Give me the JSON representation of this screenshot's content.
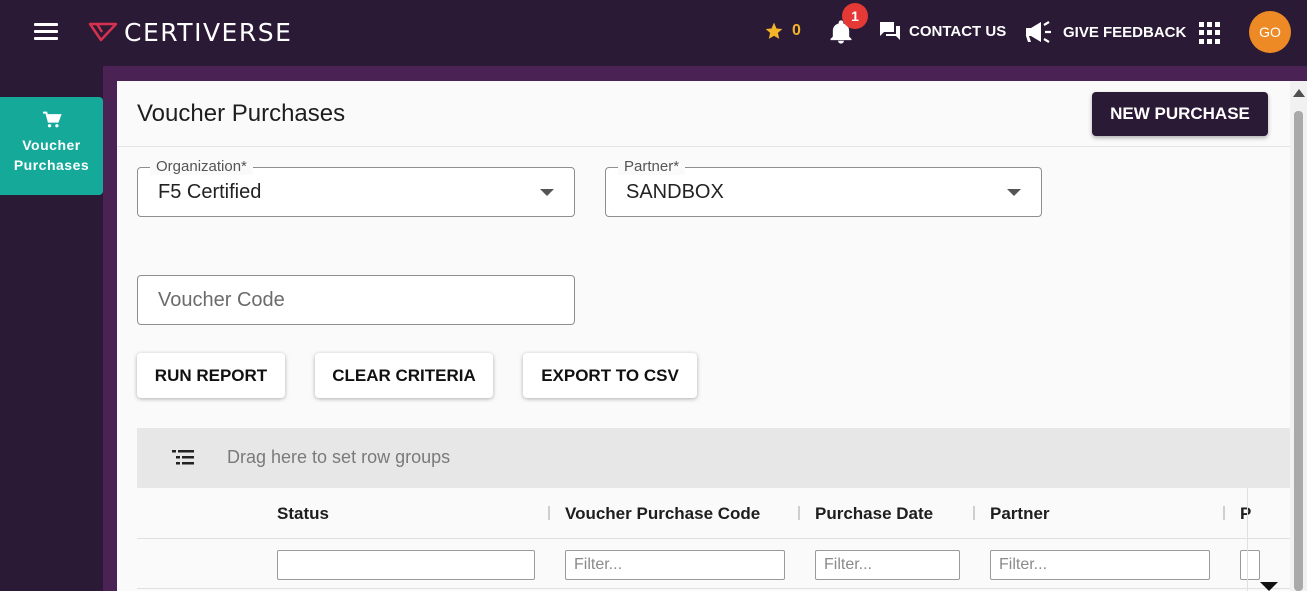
{
  "header": {
    "brand": "CERTIVERSE",
    "star_count": "0",
    "notification_count": "1",
    "contact_label": "CONTACT US",
    "feedback_label": "GIVE FEEDBACK",
    "avatar_initials": "GO",
    "colors": {
      "bar": "#2a1a35",
      "star": "#f3b42a",
      "badge": "#e53935",
      "avatar": "#ee8a25"
    }
  },
  "sidebar": {
    "items": [
      {
        "label": "Voucher Purchases",
        "icon": "cart-icon",
        "active": true
      }
    ],
    "active_color": "#15a99a"
  },
  "main": {
    "title": "Voucher Purchases",
    "new_purchase_label": "NEW PURCHASE",
    "organization": {
      "label": "Organization*",
      "value": "F5 Certified"
    },
    "partner": {
      "label": "Partner*",
      "value": "SANDBOX"
    },
    "voucher_code": {
      "placeholder": "Voucher Code"
    },
    "buttons": {
      "run_report": "RUN REPORT",
      "clear_criteria": "CLEAR CRITERIA",
      "export_csv": "EXPORT TO CSV"
    },
    "grid": {
      "group_placeholder": "Drag here to set row groups",
      "columns": [
        "Status",
        "Voucher Purchase Code",
        "Purchase Date",
        "Partner",
        "P"
      ],
      "filter_placeholder": "Filter..."
    }
  }
}
